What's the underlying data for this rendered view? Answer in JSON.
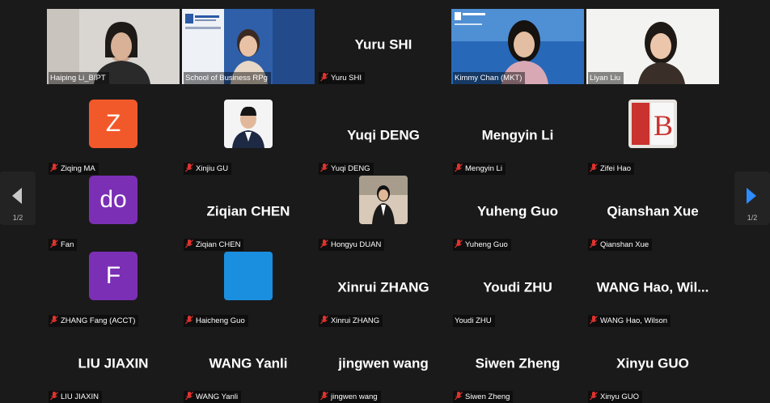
{
  "pager": {
    "left": "1/2",
    "right": "1/2"
  },
  "row1": [
    {
      "label": "Haiping Li_BIPT"
    },
    {
      "label": "School of Business RPg"
    },
    {
      "label": "Yuru SHI",
      "big": "Yuru SHI"
    },
    {
      "label": "Kimmy Chan (MKT)"
    },
    {
      "label": "Liyan Liu"
    }
  ],
  "row2": [
    {
      "label": "Ziqing MA",
      "avatar": "Z"
    },
    {
      "label": "Xinjiu GU"
    },
    {
      "label": "Yuqi DENG",
      "big": "Yuqi DENG"
    },
    {
      "label": "Mengyin Li",
      "big": "Mengyin Li"
    },
    {
      "label": "Zifei Hao"
    }
  ],
  "row3": [
    {
      "label": "Fan",
      "avatar": "do"
    },
    {
      "label": "Ziqian CHEN",
      "big": "Ziqian CHEN"
    },
    {
      "label": "Hongyu DUAN"
    },
    {
      "label": "Yuheng Guo",
      "big": "Yuheng Guo"
    },
    {
      "label": "Qianshan Xue",
      "big": "Qianshan Xue"
    }
  ],
  "row4": [
    {
      "label": "ZHANG Fang (ACCT)",
      "avatar": "F"
    },
    {
      "label": "Haicheng Guo"
    },
    {
      "label": "Xinrui ZHANG",
      "big": "Xinrui ZHANG"
    },
    {
      "label": "Youdi ZHU",
      "big": "Youdi ZHU"
    },
    {
      "label": "WANG Hao, Wilson",
      "big": "WANG Hao, Wil..."
    }
  ],
  "row5": [
    {
      "label": "LIU JIAXIN",
      "big": "LIU JIAXIN"
    },
    {
      "label": "WANG Yanli",
      "big": "WANG Yanli"
    },
    {
      "label": "jingwen wang",
      "big": "jingwen wang"
    },
    {
      "label": "Siwen Zheng",
      "big": "Siwen Zheng"
    },
    {
      "label": "Xinyu GUO",
      "big": "Xinyu GUO"
    }
  ],
  "colors": {
    "muted_icon": "#e0332e",
    "active_speaker": "#2fd18a",
    "avatar_orange": "#f2592a",
    "avatar_purple": "#7b2fb5",
    "avatar_blue": "#1a8fe0"
  }
}
